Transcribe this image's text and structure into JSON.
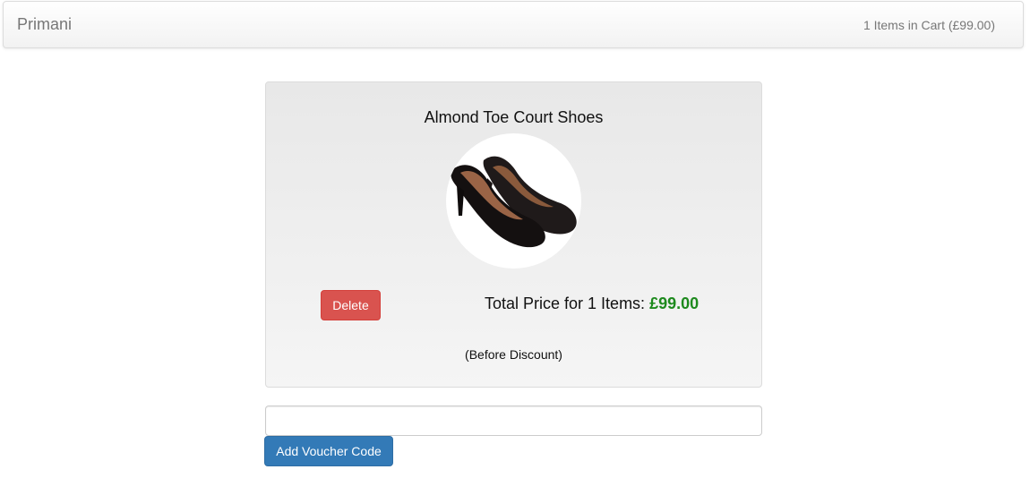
{
  "navbar": {
    "brand": "Primani",
    "cart_summary": "1 Items in Cart (£99.00)"
  },
  "cart_item": {
    "title": "Almond Toe Court Shoes",
    "image_icon": "shoe-image",
    "delete_label": "Delete",
    "total_label": "Total Price for 1 Items:",
    "total_price": "£99.00",
    "discount_note": "(Before Discount)"
  },
  "voucher": {
    "value": "",
    "placeholder": "",
    "button_label": "Add Voucher Code"
  },
  "colors": {
    "delete_button": "#d9534f",
    "voucher_button": "#337ab7",
    "price": "#1e8a1e"
  }
}
